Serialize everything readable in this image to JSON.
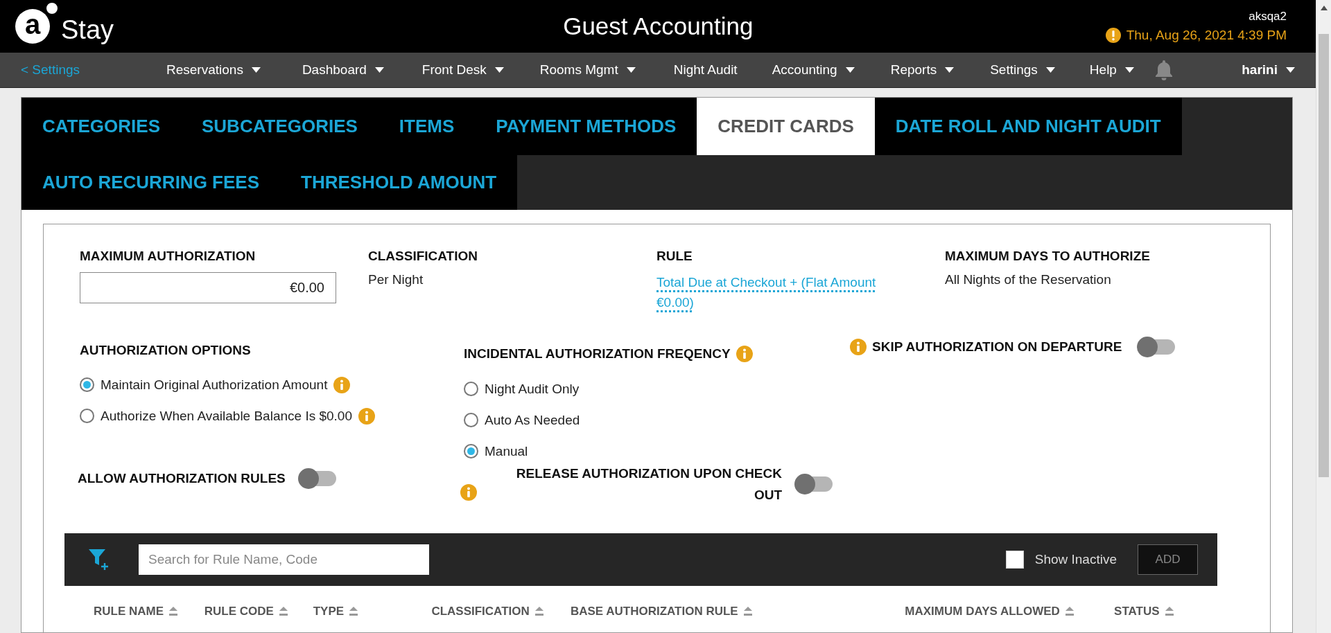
{
  "header": {
    "logo_mark": "a",
    "brand": "Stay",
    "title": "Guest Accounting",
    "user_code": "aksqa2",
    "datetime": "Thu, Aug 26, 2021 4:39 PM"
  },
  "nav": {
    "back": "< Settings",
    "items": [
      {
        "label": "Reservations",
        "dropdown": true
      },
      {
        "label": "Dashboard",
        "dropdown": true
      },
      {
        "label": "Front Desk",
        "dropdown": true
      },
      {
        "label": "Rooms Mgmt",
        "dropdown": true
      },
      {
        "label": "Night Audit",
        "dropdown": false
      },
      {
        "label": "Accounting",
        "dropdown": true
      },
      {
        "label": "Reports",
        "dropdown": true
      },
      {
        "label": "Settings",
        "dropdown": true
      },
      {
        "label": "Help",
        "dropdown": true
      }
    ],
    "user": "harini"
  },
  "tabs": [
    {
      "label": "CATEGORIES",
      "selected": false
    },
    {
      "label": "SUBCATEGORIES",
      "selected": false
    },
    {
      "label": "ITEMS",
      "selected": false
    },
    {
      "label": "PAYMENT METHODS",
      "selected": false
    },
    {
      "label": "CREDIT CARDS",
      "selected": true
    },
    {
      "label": "DATE ROLL AND NIGHT AUDIT",
      "selected": false
    },
    {
      "label": "AUTO RECURRING FEES",
      "selected": false
    },
    {
      "label": "THRESHOLD AMOUNT",
      "selected": false
    }
  ],
  "fields": [
    {
      "label": "MAXIMUM AUTHORIZATION",
      "kind": "input",
      "value": "€0.00"
    },
    {
      "label": "CLASSIFICATION",
      "kind": "text",
      "value": "Per Night"
    },
    {
      "label": "RULE",
      "kind": "link",
      "value": "Total Due at Checkout + (Flat Amount €0.00)"
    },
    {
      "label": "MAXIMUM DAYS TO AUTHORIZE",
      "kind": "text",
      "value": "All Nights of the Reservation"
    }
  ],
  "authorization_options": {
    "title": "AUTHORIZATION OPTIONS",
    "options": [
      {
        "label": "Maintain Original Authorization Amount",
        "selected": true,
        "info": true
      },
      {
        "label": "Authorize When Available Balance Is $0.00",
        "selected": false,
        "info": true
      }
    ]
  },
  "incidental_frequency": {
    "title": "INCIDENTAL AUTHORIZATION FREQENCY",
    "info": true,
    "options": [
      {
        "label": "Night Audit Only",
        "selected": false
      },
      {
        "label": "Auto As Needed",
        "selected": false
      },
      {
        "label": "Manual",
        "selected": true
      }
    ]
  },
  "skip_authorization": {
    "label": "SKIP AUTHORIZATION ON DEPARTURE",
    "info": true,
    "on": false
  },
  "allow_rules": {
    "label": "ALLOW AUTHORIZATION RULES",
    "on": false
  },
  "release_authorization": {
    "label": "RELEASE AUTHORIZATION UPON CHECK OUT",
    "info": true,
    "on": false
  },
  "rules_table": {
    "search_placeholder": "Search for Rule Name, Code",
    "show_inactive": {
      "label": "Show Inactive",
      "checked": false
    },
    "add_button": "ADD",
    "columns": [
      "RULE NAME",
      "RULE CODE",
      "TYPE",
      "CLASSIFICATION",
      "BASE AUTHORIZATION RULE",
      "MAXIMUM DAYS ALLOWED",
      "STATUS"
    ]
  }
}
